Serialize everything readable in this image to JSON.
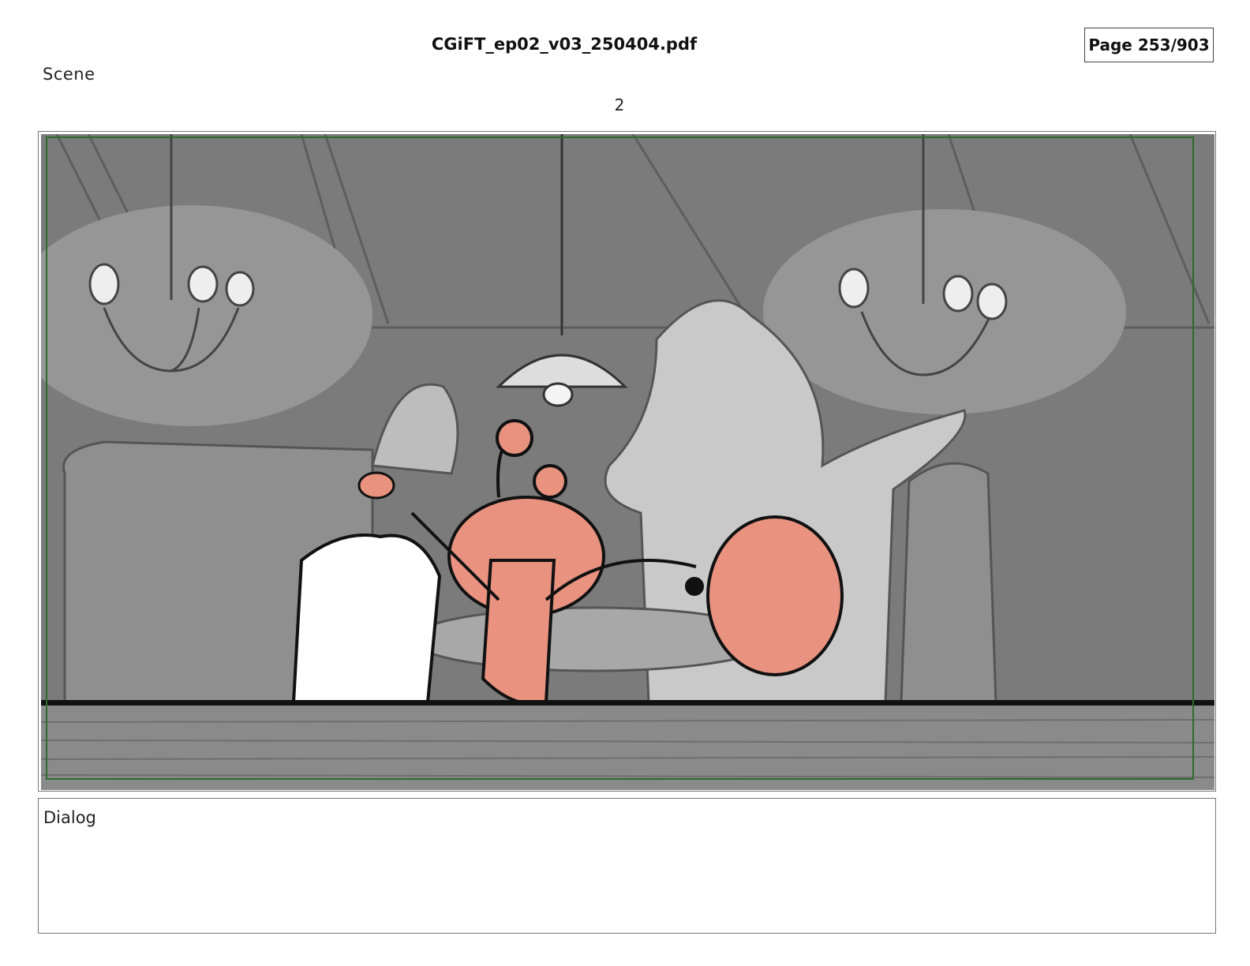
{
  "header": {
    "file_name": "CGiFT_ep02_v03_250404.pdf",
    "page_indicator": "Page 253/903"
  },
  "scene": {
    "label": "Scene",
    "number": "2"
  },
  "dialog": {
    "label": "Dialog"
  },
  "colors": {
    "character_pink": "#E8927F",
    "background_gray": "#7d7d7d",
    "safe_frame_green": "#2e6b2e"
  },
  "panel": {
    "content": "storyboard-frame"
  }
}
